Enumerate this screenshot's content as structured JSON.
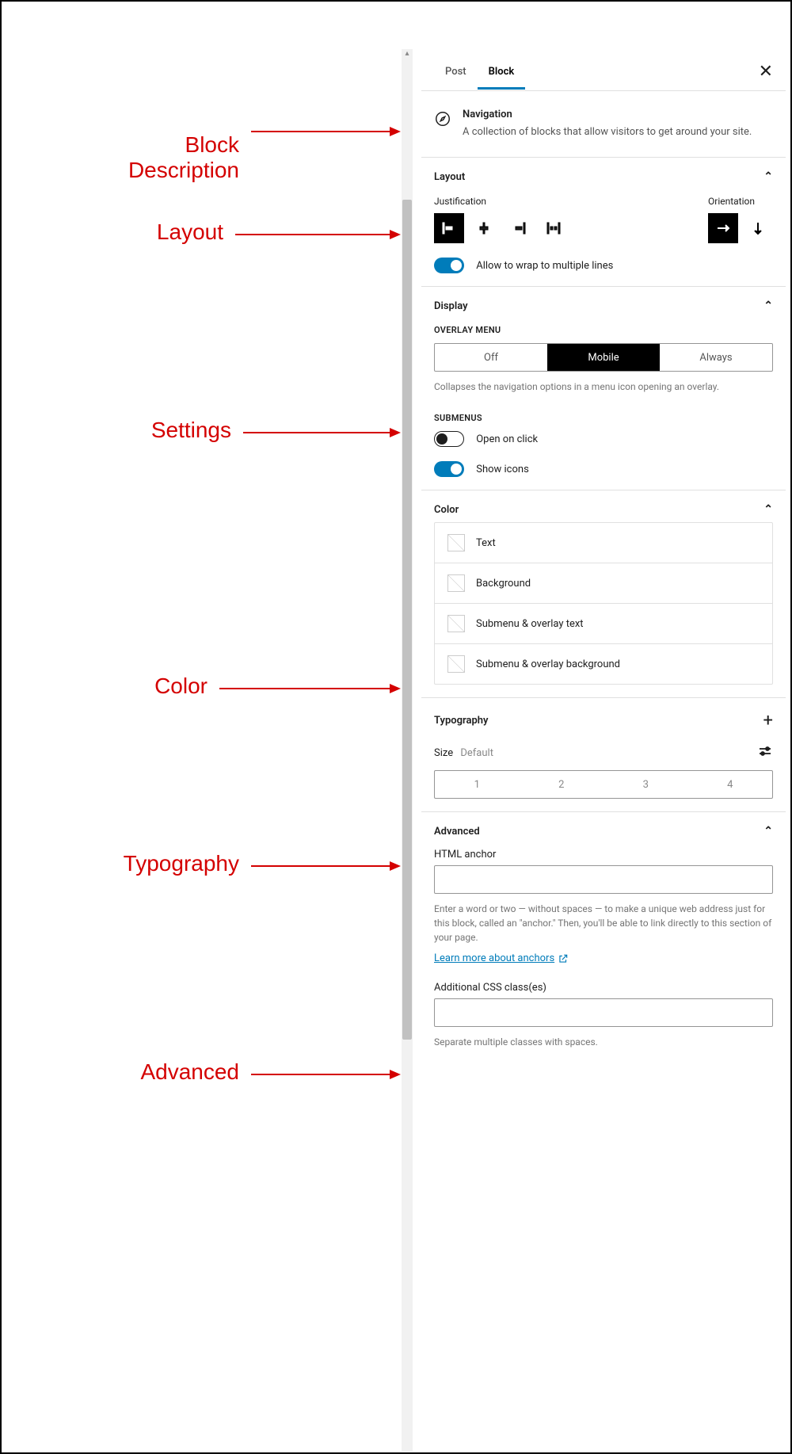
{
  "annotations": {
    "block_description": "Block\nDescription",
    "layout": "Layout",
    "settings": "Settings",
    "color": "Color",
    "typography": "Typography",
    "advanced": "Advanced"
  },
  "tabs": {
    "post": "Post",
    "block": "Block"
  },
  "block": {
    "title": "Navigation",
    "description": "A collection of blocks that allow visitors to get around your site."
  },
  "layout": {
    "heading": "Layout",
    "justification_label": "Justification",
    "orientation_label": "Orientation",
    "wrap_label": "Allow to wrap to multiple lines"
  },
  "display": {
    "heading": "Display",
    "overlay_label": "Overlay Menu",
    "options": {
      "off": "Off",
      "mobile": "Mobile",
      "always": "Always"
    },
    "overlay_help": "Collapses the navigation options in a menu icon opening an overlay.",
    "submenus_label": "Submenus",
    "open_on_click": "Open on click",
    "show_icons": "Show icons"
  },
  "color": {
    "heading": "Color",
    "items": [
      "Text",
      "Background",
      "Submenu & overlay text",
      "Submenu & overlay background"
    ]
  },
  "typography": {
    "heading": "Typography",
    "size_label": "Size",
    "size_value": "Default",
    "sizes": [
      "1",
      "2",
      "3",
      "4"
    ]
  },
  "advanced": {
    "heading": "Advanced",
    "anchor_label": "HTML anchor",
    "anchor_help": "Enter a word or two — without spaces — to make a unique web address just for this block, called an \"anchor.\" Then, you'll be able to link directly to this section of your page.",
    "anchor_link": "Learn more about anchors",
    "css_label": "Additional CSS class(es)",
    "css_help": "Separate multiple classes with spaces."
  }
}
